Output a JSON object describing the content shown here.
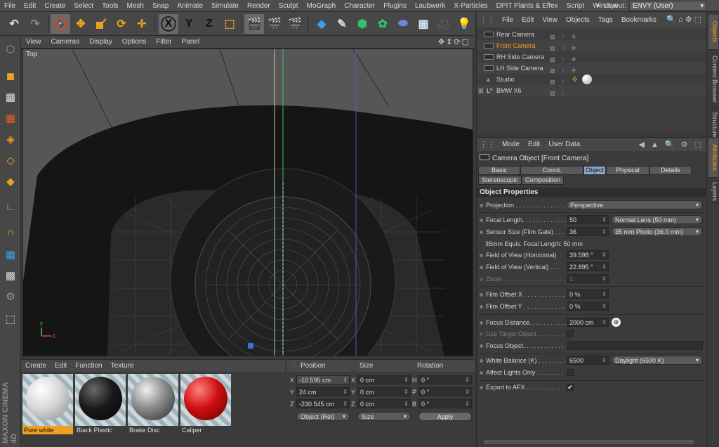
{
  "menubar": {
    "items": [
      "File",
      "Edit",
      "Create",
      "Select",
      "Tools",
      "Mesh",
      "Snap",
      "Animate",
      "Simulate",
      "Render",
      "Sculpt",
      "MoGraph",
      "Character",
      "Plugins",
      "Laubwerk",
      "X-Particles",
      "DPIT Plants & Effex",
      "Script",
      "Window"
    ],
    "layout_label": "Layout:",
    "layout_value": "ENVY (User)"
  },
  "toolbar": {
    "axis_x": "X",
    "axis_y": "Y",
    "axis_z": "Z"
  },
  "viewport": {
    "menu": [
      "View",
      "Cameras",
      "Display",
      "Options",
      "Filter",
      "Panel"
    ],
    "label": "Top"
  },
  "material_manager": {
    "menu": [
      "Create",
      "Edit",
      "Function",
      "Texture"
    ],
    "materials": [
      {
        "name": "Pure white",
        "color": "#e6e6e6"
      },
      {
        "name": "Black Plastic",
        "color": "#1a1a1a"
      },
      {
        "name": "Brake Disc",
        "color": "#8a8a8a"
      },
      {
        "name": "Caliper",
        "color": "#d01010"
      }
    ]
  },
  "maxon": {
    "brand": "MAXON",
    "product": "CINEMA 4D"
  },
  "coordinates": {
    "headers": {
      "position": "Position",
      "size": "Size",
      "rotation": "Rotation"
    },
    "rows": [
      {
        "axis": "X",
        "pos": "-10.595 cm",
        "size_axis": "X",
        "size": "0 cm",
        "rot_axis": "H",
        "rot": "0 °"
      },
      {
        "axis": "Y",
        "pos": "24 cm",
        "size_axis": "Y",
        "size": "0 cm",
        "rot_axis": "P",
        "rot": "0 °"
      },
      {
        "axis": "Z",
        "pos": "-230.545 cm",
        "size_axis": "Z",
        "size": "0 cm",
        "rot_axis": "B",
        "rot": "0 °"
      }
    ],
    "mode": "Object (Rel)",
    "size_mode": "Size",
    "apply": "Apply"
  },
  "object_manager": {
    "menu": [
      "File",
      "Edit",
      "View",
      "Objects",
      "Tags",
      "Bookmarks"
    ],
    "objects": [
      "Rear Camera",
      "Front Camera",
      "RH Side Camera",
      "LH Side Camera",
      "Studio",
      "BMW X6"
    ],
    "selected_color": "#f0a020"
  },
  "side_tabs": [
    "Objects",
    "Content Browser",
    "Structure",
    "Attributes",
    "Layers"
  ],
  "attributes": {
    "menu": [
      "Mode",
      "Edit",
      "User Data"
    ],
    "title": "Camera Object [Front Camera]",
    "tabs": [
      "Basic",
      "Coord.",
      "Object",
      "Physical",
      "Details",
      "Stereoscopic",
      "Composition"
    ],
    "section": "Object Properties",
    "projection_label": "Projection . . . . . . . . . . . . . . .",
    "projection": "Perspective",
    "focal_label": "Focal Length. . . . . . . . . . . . . .",
    "focal": "50",
    "focal_preset": "Normal Lens (50 mm)",
    "sensor_label": "Sensor Size (Film Gate) . . .",
    "sensor": "36",
    "sensor_preset": "35 mm Photo (36.0 mm)",
    "equiv": "35mm Equiv. Focal Length: 50 mm",
    "fovh_label": "Field of View (Horizontal)",
    "fovh": "39.598 °",
    "fovv_label": "Field of View (Vertical) . . .",
    "fovv": "22.895 °",
    "zoom_label": "Zoom . . . . . . . . . . . . . . . . . .",
    "zoom": "1",
    "filmx_label": "Film Offset X . . . . . . . . . . . .",
    "filmx": "0 %",
    "filmy_label": "Film Offset Y . . . . . . . . . . . .",
    "filmy": "0 %",
    "focus_label": "Focus Distance. . . . . . . . . . .",
    "focus": "2000 cm",
    "target_label": "Use Target Object . . . . . . . .",
    "focusobj_label": "Focus Object. . . . . . . . . . . .",
    "wb_label": "White Balance (K) . . . . . . . .",
    "wb": "6500",
    "wb_preset": "Daylight (6500 K)",
    "affect_label": "Affect Lights Only . . . . . . . .",
    "afx_label": "Export to AFX . . . . . . . . . . .",
    "afx_check": "✔"
  }
}
